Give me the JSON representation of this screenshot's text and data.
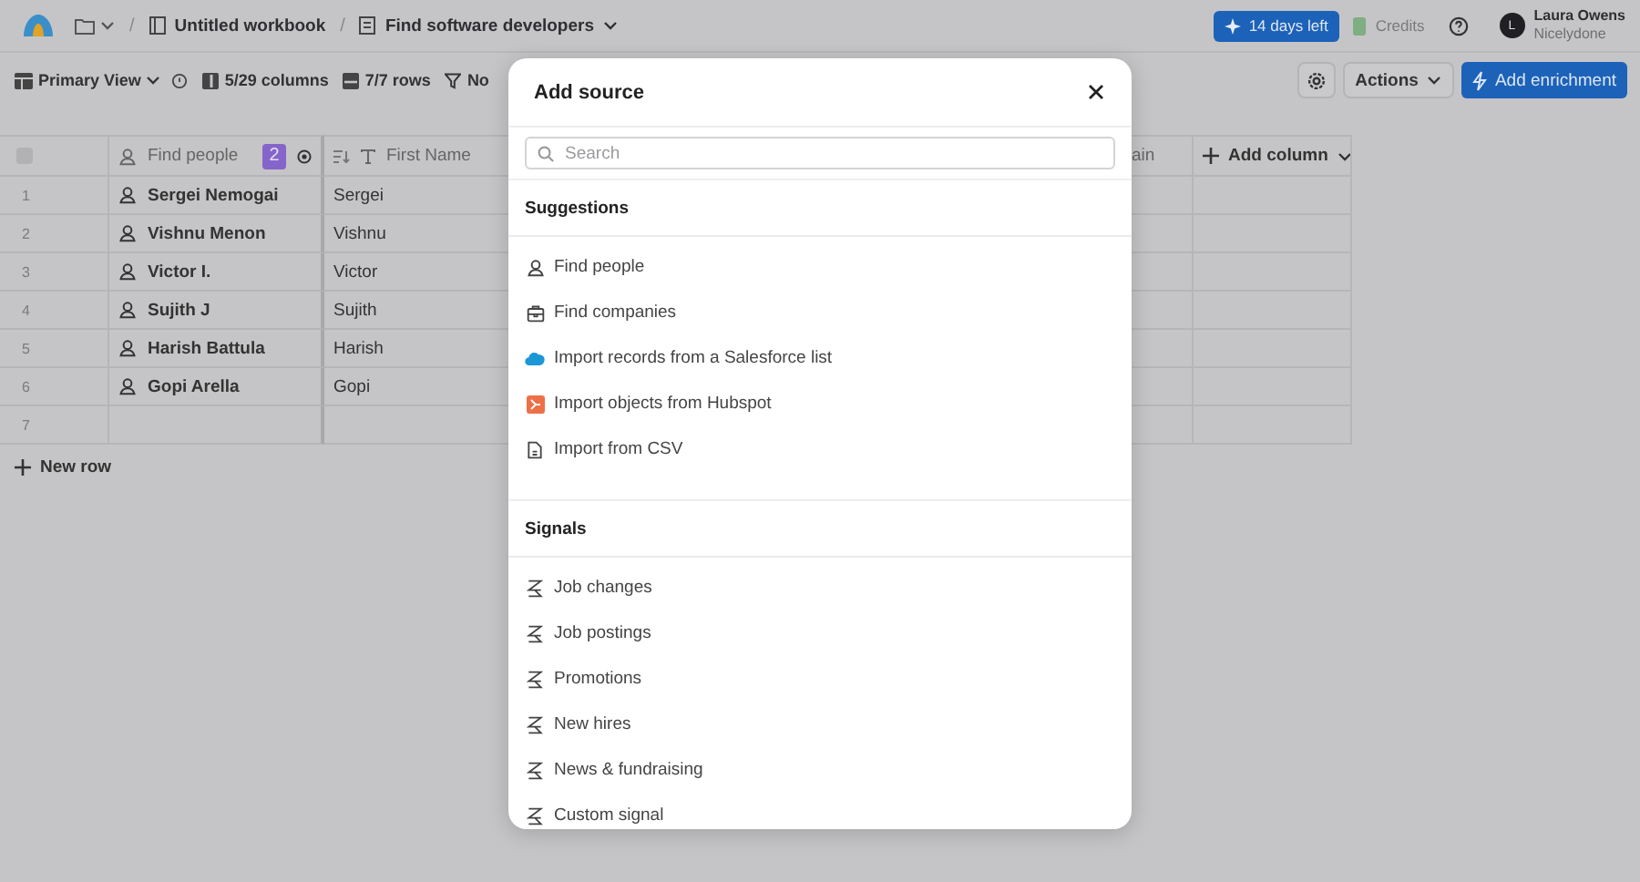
{
  "topbar": {
    "breadcrumb": [
      {
        "separator": "/",
        "label": "Untitled workbook"
      },
      {
        "separator": "/",
        "label": "Find software developers"
      }
    ],
    "trial": "14 days left",
    "credits": "Credits",
    "user": {
      "initial": "L",
      "name": "Laura Owens",
      "org": "Nicelydone"
    }
  },
  "toolbar": {
    "view": "Primary View",
    "columns": "5/29 columns",
    "rows": "7/7 rows",
    "filter": "No",
    "actions": "Actions",
    "enrich": "Add enrichment"
  },
  "table": {
    "select_all": {
      "checked": false
    },
    "columns": [
      {
        "label": "Find people",
        "badge": "2"
      },
      {
        "label": "First Name"
      },
      {
        "label": "ain"
      }
    ],
    "add_column": "Add column",
    "rows": [
      {
        "number": "1",
        "person": "Sergei Nemogai",
        "first_name": "Sergei"
      },
      {
        "number": "2",
        "person": "Vishnu Menon",
        "first_name": "Vishnu"
      },
      {
        "number": "3",
        "person": "Victor I.",
        "first_name": "Victor"
      },
      {
        "number": "4",
        "person": "Sujith J",
        "first_name": "Sujith"
      },
      {
        "number": "5",
        "person": "Harish Battula",
        "first_name": "Harish"
      },
      {
        "number": "6",
        "person": "Gopi Arella",
        "first_name": "Gopi"
      },
      {
        "number": "7"
      }
    ],
    "new_row": "New row"
  },
  "modal": {
    "title": "Add source",
    "search": {
      "placeholder": "Search"
    },
    "sections": [
      {
        "title": "Suggestions",
        "items": [
          {
            "label": "Find people",
            "kind": "person"
          },
          {
            "label": "Find companies",
            "kind": "company"
          },
          {
            "label": "Import records from a Salesforce list",
            "kind": "salesforce"
          },
          {
            "label": "Import objects from Hubspot",
            "kind": "hubspot"
          },
          {
            "label": "Import from CSV",
            "kind": "file"
          }
        ]
      },
      {
        "title": "Signals",
        "items": [
          {
            "label": "Job changes",
            "kind": "signal"
          },
          {
            "label": "Job postings",
            "kind": "signal"
          },
          {
            "label": "Promotions",
            "kind": "signal"
          },
          {
            "label": "New hires",
            "kind": "signal"
          },
          {
            "label": "News & fundraising",
            "kind": "signal"
          },
          {
            "label": "Custom signal",
            "kind": "signal"
          }
        ]
      }
    ]
  }
}
